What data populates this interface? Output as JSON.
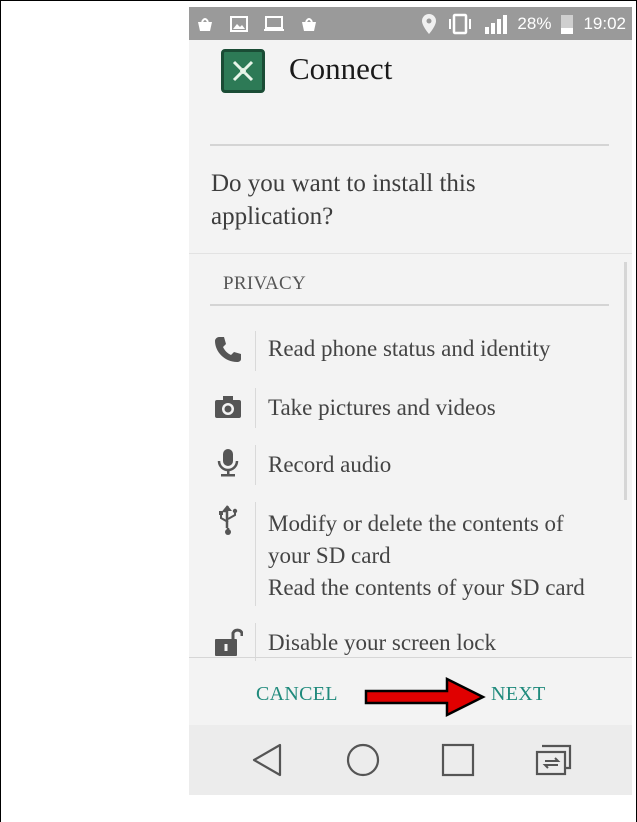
{
  "status_bar": {
    "left_icons": [
      "notification-icon",
      "gallery-icon",
      "cast-icon",
      "notification-icon"
    ],
    "right_icons": [
      "location-icon",
      "vibrate-icon",
      "signal-icon"
    ],
    "battery": "28%",
    "time": "19:02"
  },
  "app": {
    "title": "Connect",
    "icon": "app-icon"
  },
  "prompt": {
    "question": "Do you want to install this application?"
  },
  "privacy": {
    "section_label": "PRIVACY",
    "permissions": [
      {
        "icon": "phone-icon",
        "lines": [
          "Read phone status and identity"
        ]
      },
      {
        "icon": "camera-icon",
        "lines": [
          "Take pictures and videos"
        ]
      },
      {
        "icon": "microphone-icon",
        "lines": [
          "Record audio"
        ]
      },
      {
        "icon": "usb-icon",
        "lines": [
          "Modify or delete the contents of",
          "your SD card",
          "Read the contents of your SD card"
        ]
      },
      {
        "icon": "unlock-icon",
        "lines": [
          "Disable your screen lock"
        ]
      }
    ]
  },
  "actions": {
    "cancel_label": "CANCEL",
    "next_label": "NEXT"
  },
  "navigation": {
    "buttons": [
      "back-icon",
      "home-icon",
      "recents-icon",
      "switch-icon"
    ]
  },
  "colors": {
    "status_bar": "#9a9a9a",
    "accent": "#1f8a7c",
    "arrow": "#e00000",
    "app_icon": "#2d7a56"
  }
}
